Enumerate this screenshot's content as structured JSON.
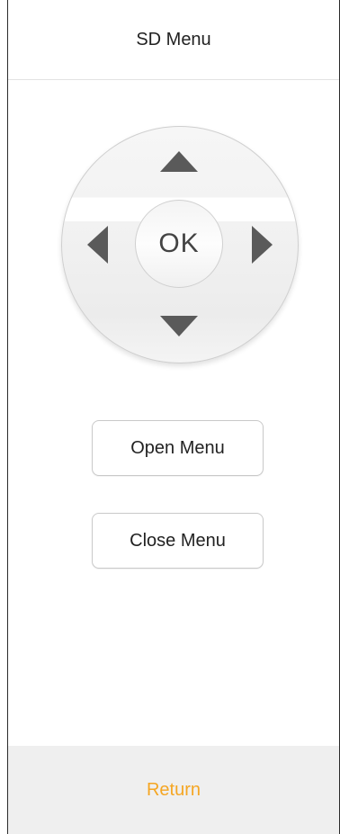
{
  "header": {
    "title": "SD Menu"
  },
  "dpad": {
    "ok_label": "OK"
  },
  "actions": {
    "open_label": "Open Menu",
    "close_label": "Close Menu"
  },
  "footer": {
    "return_label": "Return"
  },
  "colors": {
    "accent": "#f5a623",
    "arrow": "#5a5a5a",
    "footer_bg": "#efefef"
  },
  "icons": [
    "arrow-up-icon",
    "arrow-down-icon",
    "arrow-left-icon",
    "arrow-right-icon"
  ]
}
